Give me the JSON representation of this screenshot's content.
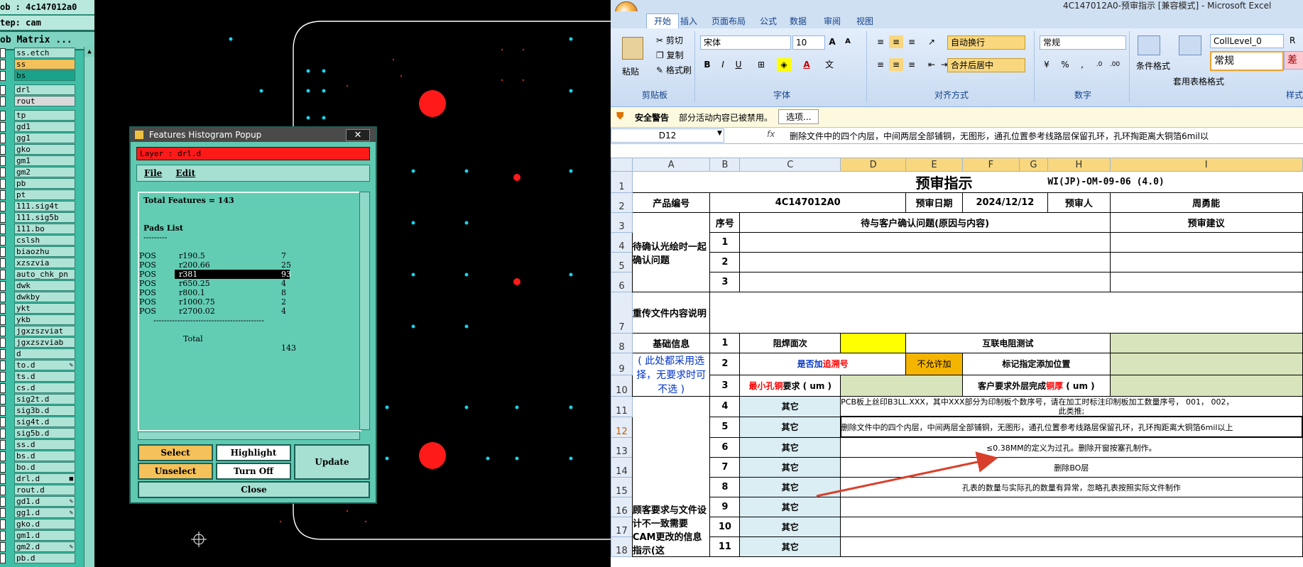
{
  "cam": {
    "job_label": "ob : 4c147012a0",
    "step_label": "tep: cam",
    "matrix_button": "ob Matrix ...",
    "layers_top": [
      {
        "name": "ss.etch",
        "color": "#aee3d6"
      },
      {
        "name": "ss",
        "color": "#f5c15a"
      },
      {
        "name": "bs",
        "color": "#1aa38a"
      }
    ],
    "layers_drill": [
      {
        "name": "drl",
        "color": "#aee3d6"
      },
      {
        "name": "rout",
        "color": "#d9d9d9"
      }
    ],
    "layers_misc": [
      {
        "name": "tp",
        "mark": ""
      },
      {
        "name": "gd1",
        "mark": ""
      },
      {
        "name": "gg1",
        "mark": ""
      },
      {
        "name": "gko",
        "mark": ""
      },
      {
        "name": "gm1",
        "mark": ""
      },
      {
        "name": "gm2",
        "mark": ""
      },
      {
        "name": "pb",
        "mark": ""
      },
      {
        "name": "pt",
        "mark": ""
      },
      {
        "name": "111.sig4t",
        "mark": ""
      },
      {
        "name": "111.sig5b",
        "mark": ""
      },
      {
        "name": "111.bo",
        "mark": ""
      },
      {
        "name": "cslsh",
        "mark": ""
      },
      {
        "name": "biaozhu",
        "mark": ""
      },
      {
        "name": "xzszvia",
        "mark": ""
      },
      {
        "name": "auto_chk_pn",
        "mark": ""
      },
      {
        "name": "dwk",
        "mark": ""
      },
      {
        "name": "dwkby",
        "mark": ""
      },
      {
        "name": "ykt",
        "mark": ""
      },
      {
        "name": "ykb",
        "mark": ""
      },
      {
        "name": "jgxzszviat",
        "mark": ""
      },
      {
        "name": "jgxzszviab",
        "mark": ""
      },
      {
        "name": "d",
        "mark": ""
      },
      {
        "name": "to.d",
        "mark": "✎"
      },
      {
        "name": "ts.d",
        "mark": ""
      },
      {
        "name": "cs.d",
        "mark": ""
      },
      {
        "name": "sig2t.d",
        "mark": ""
      },
      {
        "name": "sig3b.d",
        "mark": ""
      },
      {
        "name": "sig4t.d",
        "mark": ""
      },
      {
        "name": "sig5b.d",
        "mark": ""
      },
      {
        "name": "ss.d",
        "mark": ""
      },
      {
        "name": "bs.d",
        "mark": ""
      },
      {
        "name": "bo.d",
        "mark": ""
      },
      {
        "name": "drl.d",
        "mark": "■"
      },
      {
        "name": "rout.d",
        "mark": ""
      },
      {
        "name": "gd1.d",
        "mark": "✎"
      },
      {
        "name": "gg1.d",
        "mark": "✎"
      },
      {
        "name": "gko.d",
        "mark": ""
      },
      {
        "name": "gm1.d",
        "mark": ""
      },
      {
        "name": "gm2.d",
        "mark": "✎"
      },
      {
        "name": "pb.d",
        "mark": ""
      }
    ]
  },
  "histogram": {
    "window_title": "Features Histogram Popup",
    "close_x": "✕",
    "layer_label": "Layer :  drl.d",
    "menu": {
      "file": "File",
      "edit": "Edit"
    },
    "total_line": "Total Features = 143",
    "pads_title": "Pads List",
    "pads_underline": "---------",
    "rows": [
      {
        "type": "POS",
        "sym": "r190.5",
        "count": "7",
        "selected": false
      },
      {
        "type": "POS",
        "sym": "r200.66",
        "count": "25",
        "selected": false
      },
      {
        "type": "POS",
        "sym": "r381",
        "count": "93",
        "selected": true
      },
      {
        "type": "POS",
        "sym": "r650.25",
        "count": "4",
        "selected": false
      },
      {
        "type": "POS",
        "sym": "r800.1",
        "count": "8",
        "selected": false
      },
      {
        "type": "POS",
        "sym": "r1000.75",
        "count": "2",
        "selected": false
      },
      {
        "type": "POS",
        "sym": "r2700.02",
        "count": "4",
        "selected": false
      }
    ],
    "divider": "------------------------------------------",
    "total_label": "Total",
    "total_value": "143",
    "buttons": {
      "select": "Select",
      "highlight": "Highlight",
      "update": "Update",
      "unselect": "Unselect",
      "turn_off": "Turn Off",
      "close": "Close"
    },
    "colors": {
      "select_btn": "#f5c15a",
      "active_layer": "#ff1a1a"
    }
  },
  "excel": {
    "window_title": "4C147012A0-预审指示 [兼容模式] - Microsoft Excel",
    "tabs": [
      "开始",
      "插入",
      "页面布局",
      "公式",
      "数据",
      "审阅",
      "视图"
    ],
    "active_tab": "开始",
    "clipboard": {
      "paste": "粘贴",
      "cut": "剪切",
      "copy": "复制",
      "format_painter": "格式刷",
      "group": "剪贴板"
    },
    "font": {
      "name": "宋体",
      "size": "10",
      "group": "字体"
    },
    "alignment": {
      "wrap": "自动换行",
      "merge": "合并后居中",
      "group": "对齐方式"
    },
    "number": {
      "format": "常规",
      "group": "数字"
    },
    "styles": {
      "conditional": "条件格式",
      "table": "套用表格格式",
      "cell_style_name": "CollLevel_0",
      "normal": "常规",
      "bad": "差",
      "group": "样式",
      "col_r": "R"
    },
    "security": {
      "title": "安全警告",
      "message": "部分活动内容已被禁用。",
      "options": "选项..."
    },
    "name_box": "D12",
    "formula": "删除文件中的四个内层，中间两层全部铺铜，无图形，通孔位置参考线路层保留孔环，孔环掏距离大铜箔6mil以",
    "fx": "fx",
    "columns": [
      "A",
      "B",
      "C",
      "D",
      "E",
      "F",
      "G",
      "H",
      "I"
    ],
    "rows": [
      "1",
      "2",
      "3",
      "4",
      "5",
      "6",
      "7",
      "8",
      "9",
      "10",
      "11",
      "12",
      "13",
      "14",
      "15",
      "16",
      "17",
      "18"
    ],
    "sheet": {
      "title": "预审指示",
      "doc_code": "WI(JP)-OM-09-06 (4.0)",
      "product_no_label": "产品编号",
      "product_no": "4C147012A0",
      "review_date_label": "预审日期",
      "review_date": "2024/12/12",
      "reviewer_label": "预审人",
      "reviewer": "周勇能",
      "seq_label": "序号",
      "question_label": "待与客户确认问题(原因与内容)",
      "suggestion_label": "预审建议",
      "pending_label": "待确认光绘时一起确认问题",
      "reupload_label": "重传文件内容说明",
      "basic_label": "基础信息",
      "basic_note": "( 此处都采用选择，无要求时可不选 )",
      "soldermask_label": "阻焊面次",
      "impedance_label": "互联电阻测试",
      "trace_label_a": "是否加",
      "trace_label_b": "追溯号",
      "not_allowed": "不允许加",
      "mark_label": "标记指定添加位置",
      "min_hole_a": "最小孔铜",
      "min_hole_b": "要求 ( um )",
      "outer_cu_a": "客户要求外层完成",
      "outer_cu_b": "铜厚",
      "outer_cu_c": " ( um )",
      "other": "其它",
      "customer_label": "顾客要求与文件设计不一致需要CAM更改的信息指示(这",
      "item4": "PCB板上丝印B3LL.XXX，其中XXX部分为印制板个数序号，请在加工时标注印制板加工数量序号， 001， 002，",
      "item4b": "此类推;",
      "item5": "删除文件中的四个内层，中间两层全部铺铜，无图形，通孔位置参考线路层保留孔环，孔环掏距离大铜箔6mil以上",
      "item6": "≤0.38MM的定义为过孔。删除开窗按塞孔制作。",
      "item7": "删除BO层",
      "item8": "孔表的数量与实际孔的数量有异常，忽略孔表按照实际文件制作",
      "seq": [
        "1",
        "2",
        "3",
        "1",
        "2",
        "3",
        "4",
        "5",
        "6",
        "7",
        "8",
        "9",
        "10",
        "11"
      ]
    },
    "colors": {
      "yellow": "#ffff00",
      "orange": "#f4b400",
      "green": "#d8e4bc",
      "blue_text": "#0033cc",
      "red_text": "#ff0000",
      "arrow": "#d9402b"
    }
  }
}
